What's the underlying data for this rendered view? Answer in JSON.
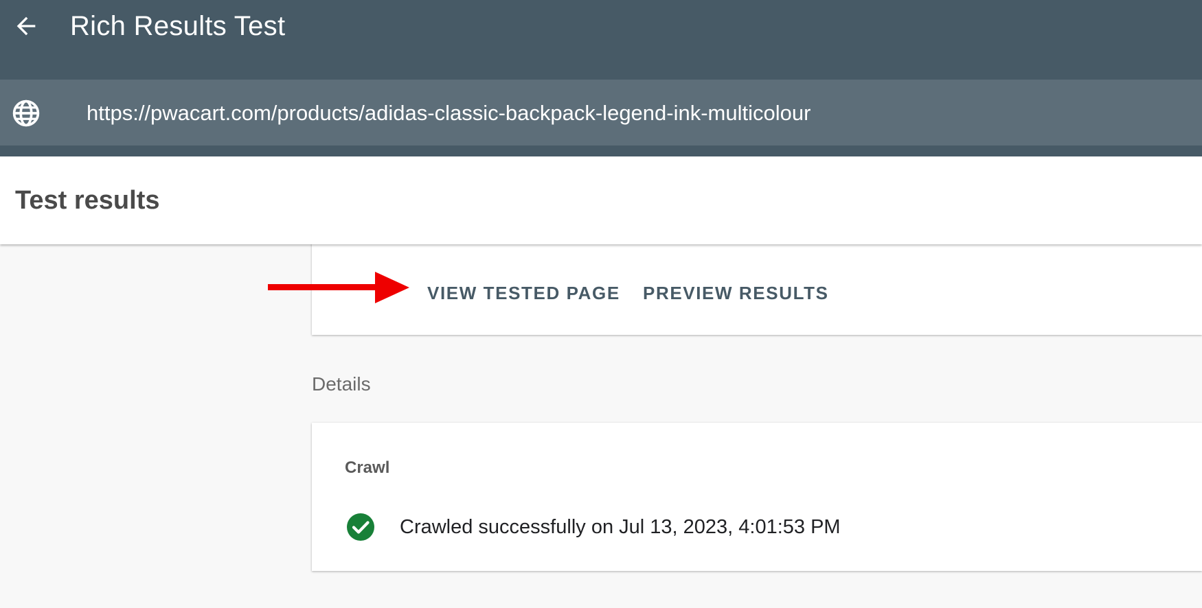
{
  "app": {
    "title": "Rich Results Test",
    "back_icon": "arrow-back-icon"
  },
  "url_bar": {
    "icon": "globe-icon",
    "url": "https://pwacart.com/products/adidas-classic-backpack-legend-ink-multicolour"
  },
  "results": {
    "title": "Test results",
    "tabs": [
      {
        "label": "VIEW TESTED PAGE"
      },
      {
        "label": "PREVIEW RESULTS"
      }
    ],
    "annotation": {
      "icon": "red-arrow-icon",
      "color": "#ee0000"
    }
  },
  "details": {
    "label": "Details",
    "crawl": {
      "label": "Crawl",
      "status_icon": "check-circle-icon",
      "status_color": "#188038",
      "status_text": "Crawled successfully on Jul 13, 2023, 4:01:53 PM"
    }
  },
  "colors": {
    "appbar": "#475a66",
    "urlbar": "#5d6e79",
    "background": "#f8f8f8",
    "tab_text": "#475a66"
  }
}
